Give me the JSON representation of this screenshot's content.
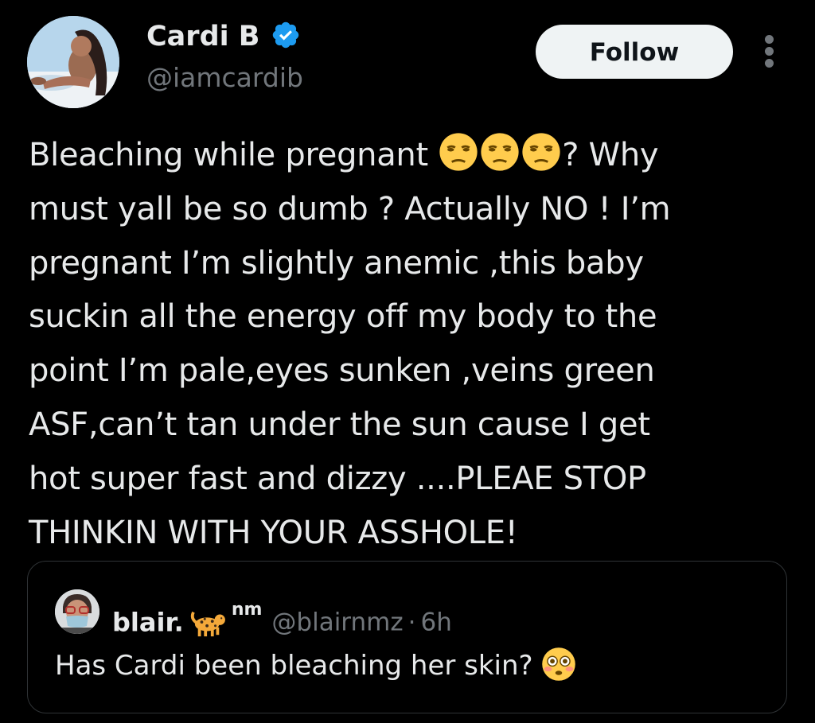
{
  "tweet": {
    "author": {
      "display_name": "Cardi B",
      "handle": "@iamcardib",
      "verified": true,
      "verified_icon": "verified-badge-icon",
      "avatar": "avatar-photo"
    },
    "follow_label": "Follow",
    "more_icon": "more-vertical-icon",
    "text_lines": [
      {
        "before": "Bleaching while pregnant ",
        "emojis": [
          "unamused-face",
          "unamused-face",
          "unamused-face"
        ],
        "after": "? Why"
      },
      {
        "text": "must yall be so dumb ? Actually NO ! I’m"
      },
      {
        "text": "pregnant I’m slightly anemic ,this baby"
      },
      {
        "text": "suckin all the energy off my body to the"
      },
      {
        "text": "point I’m pale,eyes sunken ,veins green"
      },
      {
        "text": "ASF,can’t tan under the sun cause I get"
      },
      {
        "text": "hot super fast and dizzy ....PLEAE STOP"
      },
      {
        "text": "THINKIN WITH YOUR ASSHOLE!"
      }
    ]
  },
  "quoted_tweet": {
    "display_name": "blair.",
    "name_emoji": "leopard",
    "name_suffix": "nm",
    "handle": "@blairnmz",
    "separator": "·",
    "time": "6h",
    "text": "Has Cardi been bleaching her skin?",
    "text_emoji": "flushed-face",
    "avatar": "avatar-photo"
  },
  "colors": {
    "background": "#000000",
    "primary_text": "#e7e9ea",
    "secondary_text": "#71767b",
    "verified_blue": "#1d9bf0",
    "follow_bg": "#eff3f4",
    "border": "#2f3336"
  }
}
